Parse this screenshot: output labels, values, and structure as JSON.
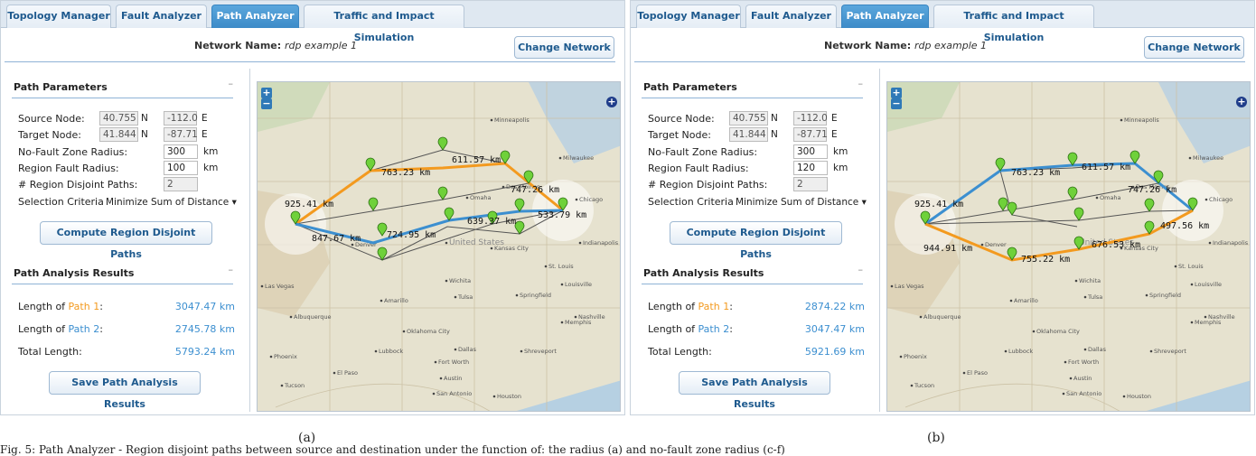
{
  "colors": {
    "path1": "#f39a1f",
    "path2": "#3c8fd0",
    "accent": "#3d8bc8",
    "link": "#1e5a8e"
  },
  "tabs": [
    "Topology Manager",
    "Fault Analyzer",
    "Path Analyzer",
    "Traffic and Impact Simulation"
  ],
  "active_tab": "Path Analyzer",
  "network_label": "Network Name:",
  "network_name": "rdp example 1",
  "change_network_label": "Change Network",
  "path_params_title": "Path Parameters",
  "collapse_glyph": "–",
  "results_title": "Path Analysis Results",
  "labels": {
    "source": "Source Node:",
    "target": "Target Node:",
    "nofault": "No-Fault Zone Radius:",
    "fault": "Region Fault Radius:",
    "disjoint": "# Region Disjoint Paths:",
    "criteria": "Selection Criteria:"
  },
  "units": {
    "north": "N",
    "east": "E",
    "km": "km"
  },
  "compute_label": "Compute Region Disjoint Paths",
  "save_label": "Save Path Analysis Results",
  "result_labels": {
    "len_prefix": "Length of ",
    "path1": "Path 1",
    "path2": "Path 2",
    "colon": ":",
    "total": "Total Length:"
  },
  "map_labels": [
    "Las Vegas",
    "Albuquerque",
    "Oklahoma City",
    "Dallas",
    "El Paso",
    "Tucson",
    "Denver",
    "Kansas City",
    "St. Louis",
    "Chicago",
    "Memphis",
    "Houston",
    "Phoenix",
    "Milwaukee",
    "Minneapolis",
    "United States",
    "Lubbock",
    "Austin",
    "San Antonio",
    "Wichita",
    "Omaha",
    "Des Moines",
    "Springfield",
    "Nashville",
    "Louisville",
    "Indianapolis",
    "Shreveport",
    "Amarillo",
    "Tulsa",
    "Fort Worth"
  ],
  "panels": {
    "a": {
      "caption": "(a)",
      "source_lat": "40.755",
      "source_lon": "-112.0",
      "target_lat": "41.844",
      "target_lon": "-87.71",
      "nofault_radius": "300",
      "fault_radius": "100",
      "disjoint_paths": "2",
      "criteria": "Minimize Sum of Distance",
      "path1_length": "3047.47 km",
      "path2_length": "2745.78 km",
      "total_length": "5793.24 km",
      "edge_labels": [
        "925.41 km",
        "763.23 km",
        "611.57 km",
        "747.26 km",
        "639.37 km",
        "533.79 km",
        "847.67 km",
        "724.95 km"
      ]
    },
    "b": {
      "caption": "(b)",
      "source_lat": "40.755",
      "source_lon": "-112.0",
      "target_lat": "41.844",
      "target_lon": "-87.71",
      "nofault_radius": "300",
      "fault_radius": "120",
      "disjoint_paths": "2",
      "criteria": "Minimize Sum of Distance",
      "path1_length": "2874.22 km",
      "path2_length": "3047.47 km",
      "total_length": "5921.69 km",
      "edge_labels": [
        "925.41 km",
        "763.23 km",
        "611.57 km",
        "747.26 km",
        "497.56 km",
        "944.91 km",
        "755.22 km",
        "676.53 km"
      ]
    }
  },
  "footer_text": "Fig. 5: Path Analyzer - Region disjoint paths between source and destination under the function of: the radius (a) and no-fault zone radius (c-f)"
}
